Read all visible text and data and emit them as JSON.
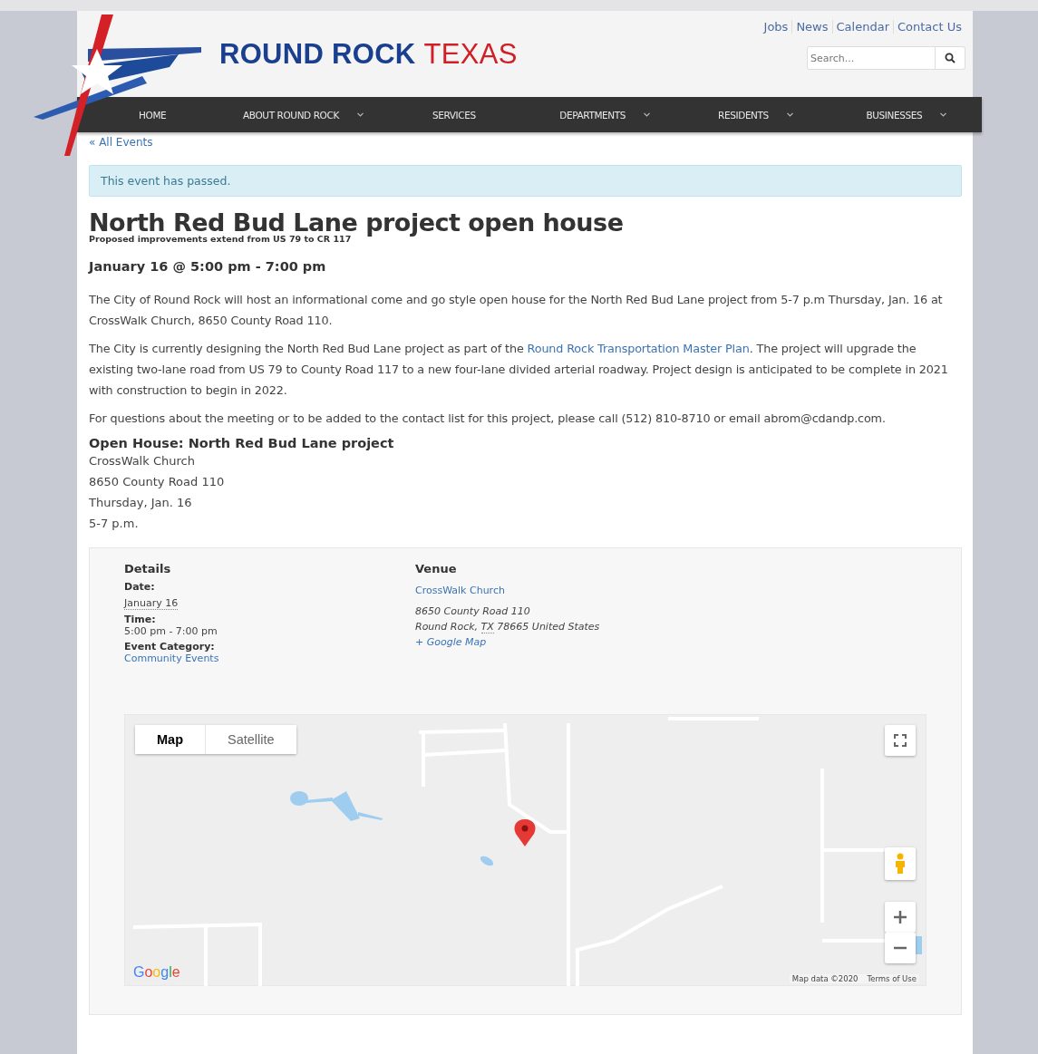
{
  "header": {
    "logo_text_primary": "ROUND ROCK",
    "logo_text_secondary": "TEXAS",
    "utility_links": [
      "Jobs",
      "News",
      "Calendar",
      "Contact Us"
    ],
    "search": {
      "placeholder": "Search..."
    }
  },
  "nav": [
    {
      "label": "HOME",
      "has_dropdown": false
    },
    {
      "label": "ABOUT ROUND ROCK",
      "has_dropdown": true
    },
    {
      "label": "SERVICES",
      "has_dropdown": false
    },
    {
      "label": "DEPARTMENTS",
      "has_dropdown": true
    },
    {
      "label": "RESIDENTS",
      "has_dropdown": true
    },
    {
      "label": "BUSINESSES",
      "has_dropdown": true
    }
  ],
  "back_link": "« All Events",
  "notice": "This event has passed.",
  "event": {
    "title": "North Red Bud Lane project open house",
    "subtitle": "Proposed improvements extend from US 79 to CR 117",
    "datetime": "January 16 @ 5:00 pm - 7:00 pm",
    "paragraphs": [
      {
        "before": "The City of Round Rock will host an informational come and go style open house for the North Red Bud Lane project from 5-7 p.m Thursday, Jan. 16 at CrossWalk Church, 8650 County Road 110."
      },
      {
        "before": "The City is currently designing the North Red Bud Lane project as part of the ",
        "link": "Round Rock Transportation Master Plan",
        "after": ". The project will upgrade the existing two-lane road from US 79 to County Road 117 to a new four-lane divided arterial roadway. Project design is anticipated to be complete in 2021 with construction to begin in 2022."
      },
      {
        "before": "For questions about the meeting or to be added to the contact list for this project, please call (512) 810-8710 or email abrom@cdandp.com."
      }
    ],
    "info_heading": "Open House: North Red Bud Lane project",
    "info_lines": [
      "CrossWalk Church",
      "8650 County Road 110",
      "Thursday, Jan. 16",
      "5-7 p.m."
    ]
  },
  "details": {
    "heading": "Details",
    "fields": [
      {
        "label": "Date:",
        "value": "January 16",
        "kind": "abbr"
      },
      {
        "label": "Time:",
        "value": "5:00 pm - 7:00 pm",
        "kind": "text"
      },
      {
        "label": "Event Category:",
        "value": "Community Events",
        "kind": "link"
      }
    ]
  },
  "venue": {
    "heading": "Venue",
    "name": "CrossWalk Church",
    "address_line": "8650 County Road 110",
    "city": "Round Rock, ",
    "state": "TX",
    "postal": " 78665 United States",
    "map_link": "+ Google Map"
  },
  "map": {
    "type_tabs": [
      {
        "label": "Map",
        "selected": true
      },
      {
        "label": "Satellite",
        "selected": false
      }
    ],
    "logo": "Google",
    "attribution": "Map data ©2020",
    "terms": "Terms of Use"
  }
}
